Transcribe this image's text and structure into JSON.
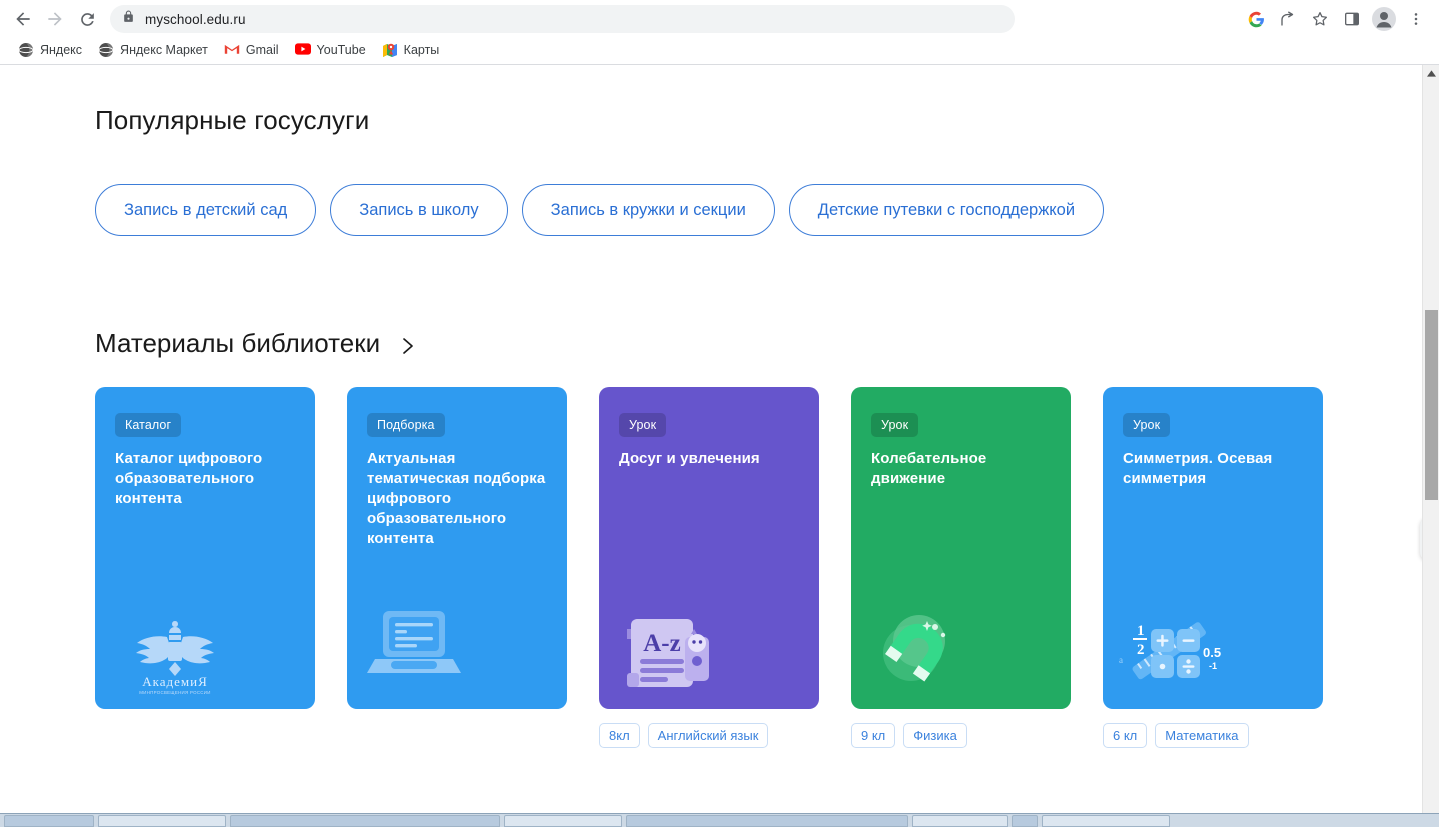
{
  "browser": {
    "url": "myschool.edu.ru",
    "nav": {
      "back": "back-arrow",
      "forward": "forward-arrow",
      "reload": "reload-icon",
      "lock": "lock-icon"
    },
    "toolbar_right": [
      "google-icon",
      "share-icon",
      "bookmark-star-icon",
      "side-panel-icon",
      "profile-avatar-icon",
      "kebab-menu-icon"
    ],
    "bookmarks": [
      {
        "label": "Яндекс",
        "icon": "yandex-globe-icon"
      },
      {
        "label": "Яндекс Маркет",
        "icon": "yandex-market-globe-icon"
      },
      {
        "label": "Gmail",
        "icon": "gmail-icon"
      },
      {
        "label": "YouTube",
        "icon": "youtube-icon"
      },
      {
        "label": "Карты",
        "icon": "maps-icon"
      }
    ]
  },
  "page": {
    "gov_services": {
      "title": "Популярные госуслуги",
      "pills": [
        "Запись в детский сад",
        "Запись в школу",
        "Запись в кружки и секции",
        "Детские путевки с господдержкой"
      ]
    },
    "library": {
      "title": "Материалы библиотеки",
      "chevron_icon": "chevron-right-icon",
      "next_button_icon": "arrow-right-icon",
      "cards": [
        {
          "badge": "Каталог",
          "title": "Каталог цифрового образовательного контента",
          "color": "#2f9bf0",
          "art": "academy-eagle-emblem",
          "tags": []
        },
        {
          "badge": "Подборка",
          "title": "Актуальная тематическая подборка цифрового образовательного контента",
          "color": "#2f9bf0",
          "art": "laptop-icon",
          "tags": []
        },
        {
          "badge": "Урок",
          "title": "Досуг и увлечения",
          "color": "#6655cc",
          "art": "document-a-z-icon",
          "tags": [
            "8кл",
            "Английский язык"
          ]
        },
        {
          "badge": "Урок",
          "title": "Колебательное движение",
          "color": "#22ab63",
          "art": "magnet-icon",
          "tags": [
            "9 кл",
            "Физика"
          ]
        },
        {
          "badge": "Урок",
          "title": "Симметрия. Осевая симметрия",
          "color": "#2f9bf0",
          "art": "math-calculator-icon",
          "tags": [
            "6 кл",
            "Математика"
          ]
        }
      ]
    }
  },
  "colors": {
    "blue_card": "#2f9bf0",
    "purple_card": "#6655cc",
    "green_card": "#22ab63",
    "pill_border": "#3d7dd8",
    "pill_text": "#2a6fd4",
    "tag_text": "#3b82dd"
  }
}
